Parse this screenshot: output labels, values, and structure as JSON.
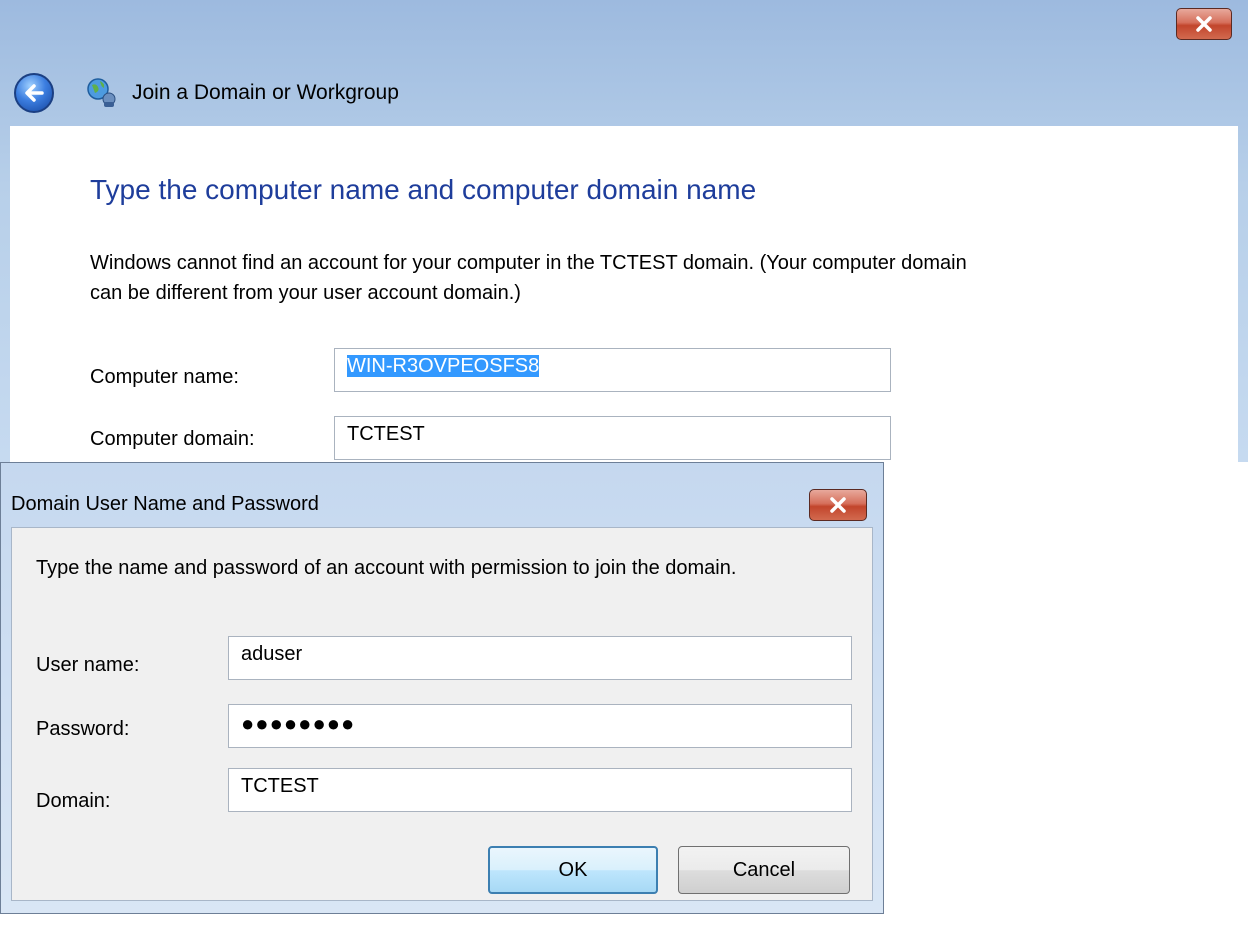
{
  "main_window": {
    "title": "Join a Domain or Workgroup",
    "heading": "Type the computer name and computer domain name",
    "description": "Windows cannot find an account for your computer in the TCTEST domain. (Your computer domain can be different from your user account domain.)",
    "computer_name_label": "Computer name:",
    "computer_name_value": "WIN-R3OVPEOSFS8",
    "computer_domain_label": "Computer domain:",
    "computer_domain_value": "TCTEST"
  },
  "credentials_dialog": {
    "title": "Domain User Name and Password",
    "instruction": "Type the name and password of an account with permission to join the domain.",
    "username_label": "User name:",
    "username_value": "aduser",
    "password_label": "Password:",
    "password_value": "●●●●●●●●",
    "domain_label": "Domain:",
    "domain_value": "TCTEST",
    "ok_label": "OK",
    "cancel_label": "Cancel"
  },
  "icons": {
    "back": "back-arrow-icon",
    "network": "network-globe-icon",
    "close": "close-icon"
  },
  "colors": {
    "heading": "#1e3d9b",
    "selection": "#3399ff",
    "close_button": "#c2452c"
  }
}
